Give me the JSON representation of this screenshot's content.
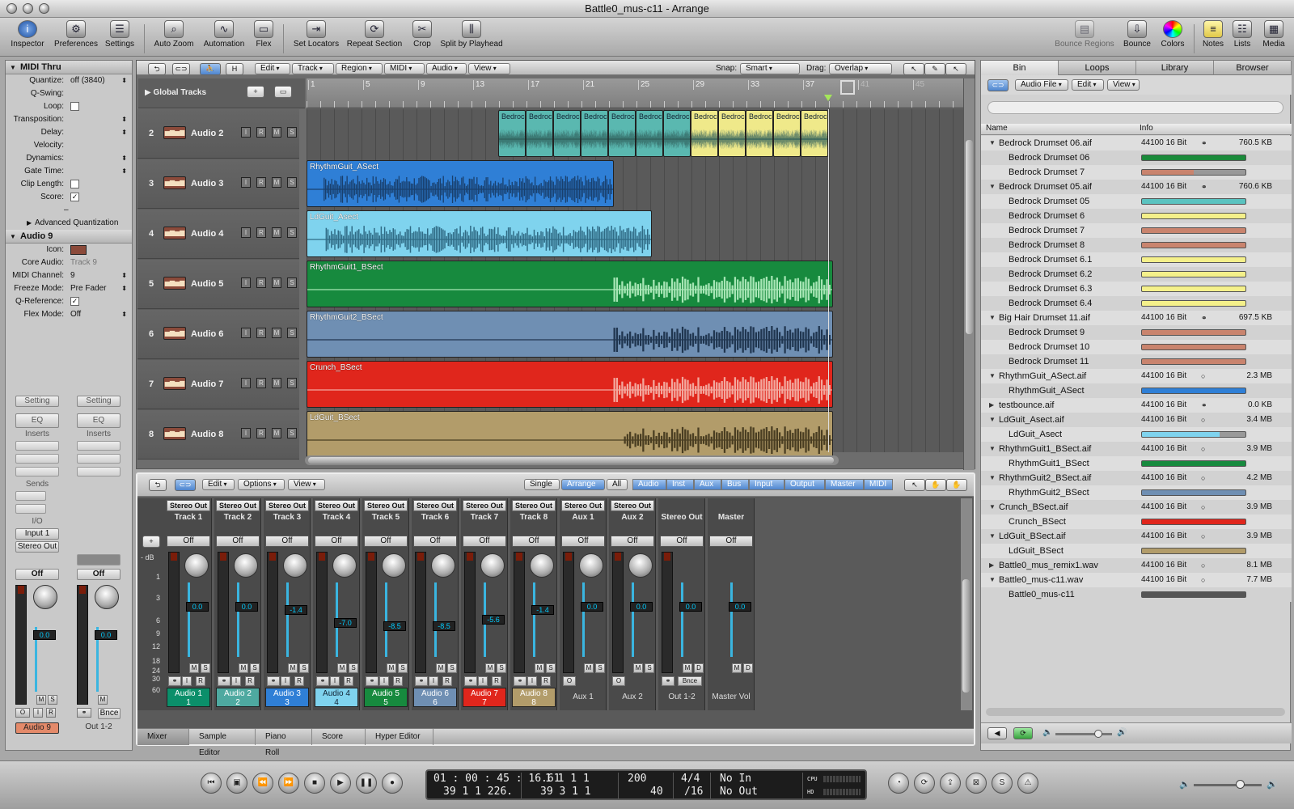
{
  "window": {
    "title": "Battle0_mus-c11 - Arrange"
  },
  "toolbar": {
    "left": [
      "Inspector",
      "Preferences",
      "Settings",
      "Auto Zoom",
      "Automation",
      "Flex",
      "Set Locators",
      "Repeat Section",
      "Crop",
      "Split by Playhead"
    ],
    "right": [
      "Bounce Regions",
      "Bounce",
      "Colors",
      "Notes",
      "Lists",
      "Media"
    ]
  },
  "inspector": {
    "section1": "MIDI Thru",
    "rows1": [
      {
        "k": "Quantize:",
        "v": "off (3840)"
      },
      {
        "k": "Q-Swing:",
        "v": ""
      },
      {
        "k": "Loop:",
        "v": ""
      },
      {
        "k": "Transposition:",
        "v": ""
      },
      {
        "k": "Delay:",
        "v": ""
      },
      {
        "k": "Velocity:",
        "v": ""
      },
      {
        "k": "Dynamics:",
        "v": ""
      },
      {
        "k": "Gate Time:",
        "v": ""
      },
      {
        "k": "Clip Length:",
        "v": ""
      },
      {
        "k": "Score:",
        "v": ""
      }
    ],
    "dash": "–",
    "advanced": "Advanced Quantization",
    "section2": "Audio 9",
    "rows2": [
      {
        "k": "Icon:",
        "v": ""
      },
      {
        "k": "Core Audio:",
        "v": "Track 9"
      },
      {
        "k": "MIDI Channel:",
        "v": "9"
      },
      {
        "k": "Freeze Mode:",
        "v": "Pre Fader"
      },
      {
        "k": "Q-Reference:",
        "v": ""
      },
      {
        "k": "Flex Mode:",
        "v": "Off"
      }
    ],
    "strip": {
      "setting": "Setting",
      "eq": "EQ",
      "inserts": "Inserts",
      "sends": "Sends",
      "io": "I/O",
      "input": "Input 1",
      "output": "Stereo Out",
      "off": "Off",
      "vol": "0.0",
      "name": "Audio 9",
      "name2": "Out 1-2",
      "bnce": "Bnce"
    }
  },
  "arrange": {
    "menus": [
      "Edit",
      "Track",
      "Region",
      "MIDI",
      "Audio",
      "View"
    ],
    "snap_label": "Snap:",
    "snap": "Smart",
    "drag_label": "Drag:",
    "drag": "Overlap",
    "global_tracks": "Global Tracks",
    "bars": [
      "1",
      "5",
      "9",
      "13",
      "17",
      "21",
      "25",
      "29",
      "33",
      "37",
      "41",
      "45"
    ],
    "tracks": [
      {
        "num": "2",
        "name": "Audio 2"
      },
      {
        "num": "3",
        "name": "Audio 3"
      },
      {
        "num": "4",
        "name": "Audio 4"
      },
      {
        "num": "5",
        "name": "Audio 5"
      },
      {
        "num": "6",
        "name": "Audio 6"
      },
      {
        "num": "7",
        "name": "Audio 7"
      },
      {
        "num": "8",
        "name": "Audio 8"
      }
    ],
    "regions": [
      {
        "label": "RhythmGuit_ASect",
        "color": "#2f7fd6"
      },
      {
        "label": "LdGuit_Asect",
        "color": "#7fd3ee"
      },
      {
        "label": "RhythmGuit1_BSect",
        "color": "#178a3e"
      },
      {
        "label": "RhythmGuit2_BSect",
        "color": "#6f8fb3"
      },
      {
        "label": "Crunch_BSect",
        "color": "#e0261c"
      },
      {
        "label": "LdGuit_BSect",
        "color": "#b29c6a"
      }
    ],
    "drum_label": "Bedroc"
  },
  "mixer": {
    "menus": [
      "Edit",
      "Options",
      "View"
    ],
    "views": [
      "Single",
      "Arrange",
      "All"
    ],
    "filters": [
      "Audio",
      "Inst",
      "Aux",
      "Bus",
      "Input",
      "Output",
      "Master",
      "MIDI"
    ],
    "db_label": "- dB",
    "scale": [
      "1",
      "3",
      "6",
      "9",
      "12",
      "18",
      "24",
      "30",
      "60"
    ],
    "channels": [
      {
        "out": "Stereo Out",
        "trk": "Track 1",
        "vol": "0.0",
        "name": "Audio 1",
        "n2": "1",
        "color": "#0b8f6a"
      },
      {
        "out": "Stereo Out",
        "trk": "Track 2",
        "vol": "0.0",
        "name": "Audio 2",
        "n2": "2",
        "color": "#4ea9a0"
      },
      {
        "out": "Stereo Out",
        "trk": "Track 3",
        "vol": "-1.4",
        "name": "Audio 3",
        "n2": "3",
        "color": "#2f7fd6"
      },
      {
        "out": "Stereo Out",
        "trk": "Track 4",
        "vol": "-7.0",
        "name": "Audio 4",
        "n2": "4",
        "color": "#7fd3ee"
      },
      {
        "out": "Stereo Out",
        "trk": "Track 5",
        "vol": "-8.5",
        "name": "Audio 5",
        "n2": "5",
        "color": "#178a3e"
      },
      {
        "out": "Stereo Out",
        "trk": "Track 6",
        "vol": "-8.5",
        "name": "Audio 6",
        "n2": "6",
        "color": "#6f8fb3"
      },
      {
        "out": "Stereo Out",
        "trk": "Track 7",
        "vol": "-5.6",
        "name": "Audio 7",
        "n2": "7",
        "color": "#e0261c"
      },
      {
        "out": "Stereo Out",
        "trk": "Track 8",
        "vol": "-1.4",
        "name": "Audio 8",
        "n2": "8",
        "color": "#b29c6a"
      },
      {
        "out": "Stereo Out",
        "trk": "Aux 1",
        "vol": "0.0",
        "name": "Aux 1",
        "n2": "",
        "color": ""
      },
      {
        "out": "Stereo Out",
        "trk": "Aux 2",
        "vol": "0.0",
        "name": "Aux 2",
        "n2": "",
        "color": ""
      },
      {
        "out": "",
        "trk": "Stereo Out",
        "vol": "0.0",
        "name": "Out 1-2",
        "n2": "",
        "color": ""
      },
      {
        "out": "",
        "trk": "Master",
        "vol": "0.0",
        "name": "Master Vol",
        "n2": "",
        "color": ""
      }
    ],
    "off": "Off",
    "tabs": [
      "Mixer",
      "Sample Editor",
      "Piano Roll",
      "Score",
      "Hyper Editor"
    ]
  },
  "bin": {
    "tabs": [
      "Bin",
      "Loops",
      "Library",
      "Browser"
    ],
    "menus": [
      "Audio File",
      "Edit",
      "View"
    ],
    "col_name": "Name",
    "col_info": "Info",
    "rows": [
      {
        "name": "Bedrock Drumset 06.aif",
        "lvl": 0,
        "info": "44100 16 Bit",
        "size": "760.5 KB"
      },
      {
        "name": "Bedrock Drumset 06",
        "lvl": 1,
        "bar": "#1a8a3a",
        "fill": 1
      },
      {
        "name": "Bedrock Drumset 7",
        "lvl": 1,
        "bar": "#c9846e",
        "fill": 0.5
      },
      {
        "name": "Bedrock Drumset 05.aif",
        "lvl": 0,
        "info": "44100 16 Bit",
        "size": "760.6 KB"
      },
      {
        "name": "Bedrock Drumset 05",
        "lvl": 1,
        "bar": "#5ac3c0",
        "fill": 1
      },
      {
        "name": "Bedrock Drumset 6",
        "lvl": 1,
        "bar": "#f4f08a",
        "fill": 1
      },
      {
        "name": "Bedrock Drumset 7",
        "lvl": 1,
        "bar": "#c9846e",
        "fill": 1
      },
      {
        "name": "Bedrock Drumset 8",
        "lvl": 1,
        "bar": "#c9846e",
        "fill": 1
      },
      {
        "name": "Bedrock Drumset 6.1",
        "lvl": 1,
        "bar": "#f4f08a",
        "fill": 1
      },
      {
        "name": "Bedrock Drumset 6.2",
        "lvl": 1,
        "bar": "#f4f08a",
        "fill": 1
      },
      {
        "name": "Bedrock Drumset 6.3",
        "lvl": 1,
        "bar": "#f4f08a",
        "fill": 1
      },
      {
        "name": "Bedrock Drumset 6.4",
        "lvl": 1,
        "bar": "#f4f08a",
        "fill": 1
      },
      {
        "name": "Big Hair Drumset 11.aif",
        "lvl": 0,
        "info": "44100 16 Bit",
        "size": "697.5 KB"
      },
      {
        "name": "Bedrock Drumset 9",
        "lvl": 1,
        "bar": "#c9846e",
        "fill": 1
      },
      {
        "name": "Bedrock Drumset 10",
        "lvl": 1,
        "bar": "#c9846e",
        "fill": 1
      },
      {
        "name": "Bedrock Drumset 11",
        "lvl": 1,
        "bar": "#c9846e",
        "fill": 1
      },
      {
        "name": "RhythmGuit_ASect.aif",
        "lvl": 0,
        "info": "44100 16 Bit",
        "size": "2.3 MB"
      },
      {
        "name": "RhythmGuit_ASect",
        "lvl": 1,
        "bar": "#2f7fd6",
        "fill": 1
      },
      {
        "name": "testbounce.aif",
        "lvl": 0,
        "info": "44100 16 Bit",
        "size": "0.0 KB",
        "closed": true
      },
      {
        "name": "LdGuit_Asect.aif",
        "lvl": 0,
        "info": "44100 16 Bit",
        "size": "3.4 MB"
      },
      {
        "name": "LdGuit_Asect",
        "lvl": 1,
        "bar": "#7fd3ee",
        "fill": 0.75
      },
      {
        "name": "RhythmGuit1_BSect.aif",
        "lvl": 0,
        "info": "44100 16 Bit",
        "size": "3.9 MB"
      },
      {
        "name": "RhythmGuit1_BSect",
        "lvl": 1,
        "bar": "#178a3e",
        "fill": 1
      },
      {
        "name": "RhythmGuit2_BSect.aif",
        "lvl": 0,
        "info": "44100 16 Bit",
        "size": "4.2 MB"
      },
      {
        "name": "RhythmGuit2_BSect",
        "lvl": 1,
        "bar": "#6f8fb3",
        "fill": 1
      },
      {
        "name": "Crunch_BSect.aif",
        "lvl": 0,
        "info": "44100 16 Bit",
        "size": "3.9 MB"
      },
      {
        "name": "Crunch_BSect",
        "lvl": 1,
        "bar": "#e0261c",
        "fill": 1
      },
      {
        "name": "LdGuit_BSect.aif",
        "lvl": 0,
        "info": "44100 16 Bit",
        "size": "3.9 MB"
      },
      {
        "name": "LdGuit_BSect",
        "lvl": 1,
        "bar": "#b29c6a",
        "fill": 1
      },
      {
        "name": "Battle0_mus_remix1.wav",
        "lvl": 0,
        "info": "44100 16 Bit",
        "size": "8.1 MB",
        "closed": true
      },
      {
        "name": "Battle0_mus-c11.wav",
        "lvl": 0,
        "info": "44100 16 Bit",
        "size": "7.7 MB"
      },
      {
        "name": "Battle0_mus-c11",
        "lvl": 1,
        "bar": "#555555",
        "fill": 1
      }
    ]
  },
  "transport": {
    "time1": "01 : 00 : 45 : 16.61",
    "time2": "39   1   1  226.",
    "pos1": "1    1    1    1",
    "pos2": "39    3    1    1",
    "tempo": "200",
    "tempo2": "40",
    "sig": "4/4",
    "div": "/16",
    "in": "No In",
    "out": "No Out",
    "cpu": "CPU",
    "hd": "HD"
  }
}
